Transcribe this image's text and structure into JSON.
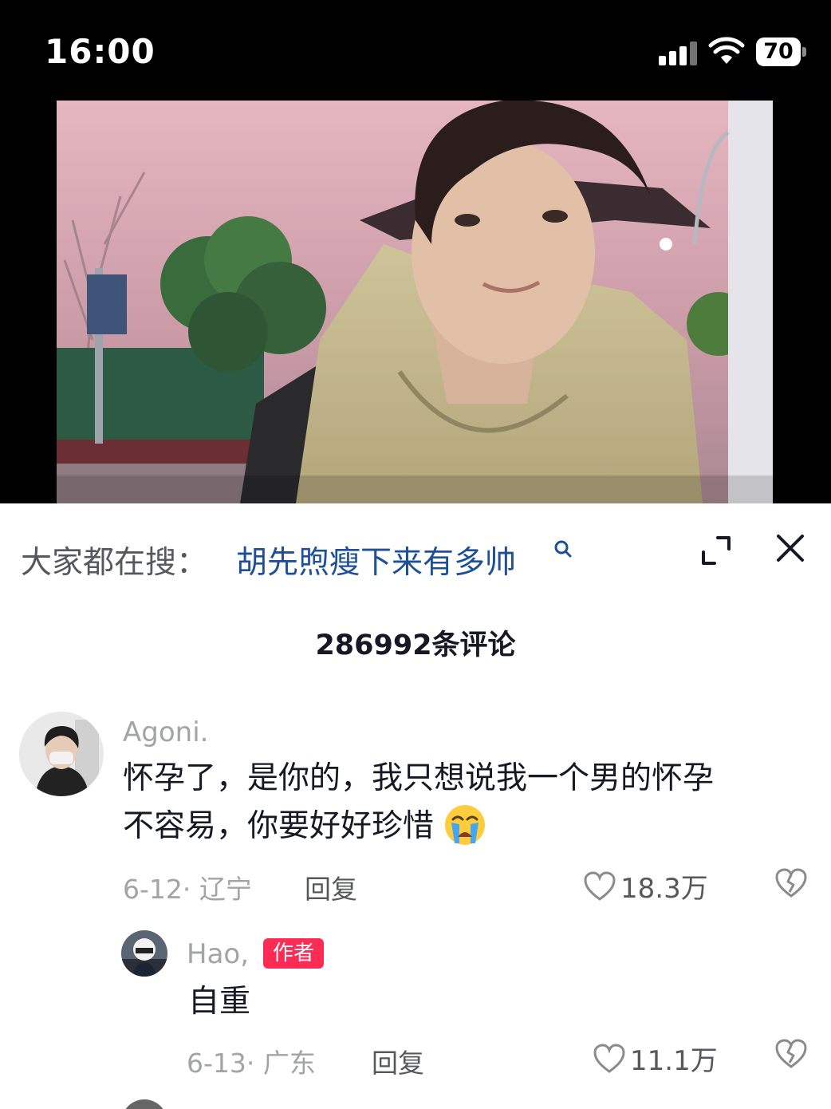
{
  "status_bar": {
    "time": "16:00",
    "battery": "70"
  },
  "search": {
    "prefix": "大家都在搜：",
    "query": "胡先煦瘦下来有多帅"
  },
  "comments_header": {
    "count_label": "286992条评论"
  },
  "comments": [
    {
      "username": "Agoni.",
      "text_line1": "怀孕了，是你的，我只想说我一个男的怀孕",
      "text_line2": "不容易，你要好好珍惜",
      "emoji": "crying-face",
      "date_location": "6-12· 辽宁",
      "reply_label": "回复",
      "likes": "18.3万"
    }
  ],
  "replies": [
    {
      "username": "Hao,",
      "badge": "作者",
      "text": "自重",
      "date_location": "6-13· 广东",
      "reply_label": "回复",
      "likes": "11.1万"
    }
  ],
  "colors": {
    "link": "#1f4f94",
    "author_badge": "#fe2c55",
    "muted_text": "#a3a4a8"
  }
}
